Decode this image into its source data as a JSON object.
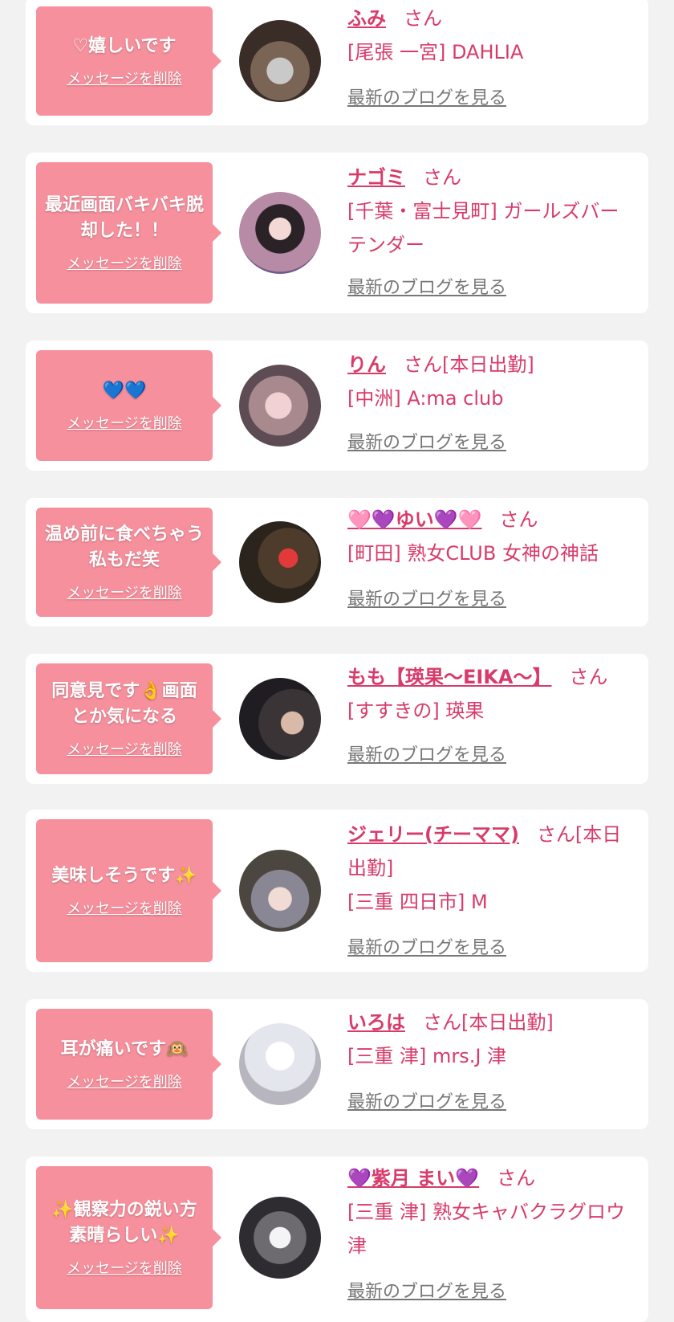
{
  "colors": {
    "accent": "#d83b6a",
    "bubble": "#f7909d",
    "link_gray": "#777777",
    "background": "#f2f2f2"
  },
  "delete_label": "メッセージを削除",
  "blog_label": "最新のブログを見る",
  "honorific": "さん",
  "items": [
    {
      "message": "♡嬉しいです",
      "name": "ふみ",
      "suffix": "さん",
      "store": "[尾張 一宮] DAHLIA",
      "avatar_icon": "avatar-photo"
    },
    {
      "message": "最近画面バキバキ脱却した！！",
      "name": "ナゴミ",
      "suffix": "さん",
      "store": "[千葉・富士見町] ガールズバーテンダー",
      "avatar_icon": "avatar-photo"
    },
    {
      "message": "💙💙",
      "name": "りん",
      "suffix": "さん[本日出勤]",
      "store": "[中洲] A:ma club",
      "avatar_icon": "avatar-photo"
    },
    {
      "message": "温め前に食べちゃう私もだ笑",
      "name": "🩷💜ゆい💜🩷",
      "suffix": "さん",
      "store": "[町田] 熟女CLUB 女神の神話",
      "avatar_icon": "avatar-photo"
    },
    {
      "message": "同意見です👌画面とか気になる",
      "name": "もも【瑛果〜EIKA〜】",
      "suffix": "さん",
      "store": "[すすきの] 瑛果",
      "avatar_icon": "avatar-photo"
    },
    {
      "message": "美味しそうです✨",
      "name": "ジェリー(チーママ)",
      "suffix": "さん[本日出勤]",
      "store": "[三重 四日市] M",
      "avatar_icon": "avatar-photo"
    },
    {
      "message": "耳が痛いです🙉",
      "name": "いろは",
      "suffix": "さん[本日出勤]",
      "store": "[三重 津] mrs.J 津",
      "avatar_icon": "avatar-photo"
    },
    {
      "message": "✨観察力の鋭い方素晴らしい✨",
      "name": "💜紫月 まい💜",
      "suffix": "さん",
      "store": "[三重 津] 熟女キャバクラグロウ津",
      "avatar_icon": "avatar-photo"
    }
  ]
}
